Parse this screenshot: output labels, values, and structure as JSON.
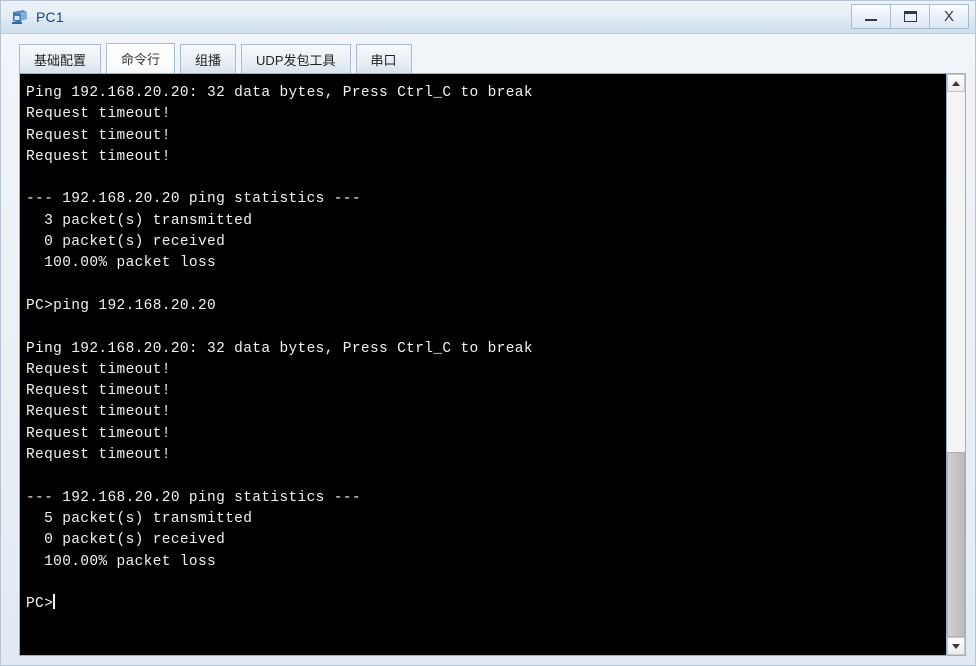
{
  "window": {
    "title": "PC1",
    "icon": "pc-device-icon",
    "controls": {
      "minimize_label": "—",
      "maximize_label": "▢",
      "close_label": "X"
    }
  },
  "tabs": [
    {
      "label": "基础配置",
      "active": false
    },
    {
      "label": "命令行",
      "active": true
    },
    {
      "label": "组播",
      "active": false
    },
    {
      "label": "UDP发包工具",
      "active": false
    },
    {
      "label": "串口",
      "active": false
    }
  ],
  "terminal": {
    "background": "#000000",
    "foreground": "#f2f2f2",
    "prompt": "PC>",
    "lines": [
      "Ping 192.168.20.20: 32 data bytes, Press Ctrl_C to break",
      "Request timeout!",
      "Request timeout!",
      "Request timeout!",
      "",
      "--- 192.168.20.20 ping statistics ---",
      "  3 packet(s) transmitted",
      "  0 packet(s) received",
      "  100.00% packet loss",
      "",
      "PC>ping 192.168.20.20",
      "",
      "Ping 192.168.20.20: 32 data bytes, Press Ctrl_C to break",
      "Request timeout!",
      "Request timeout!",
      "Request timeout!",
      "Request timeout!",
      "Request timeout!",
      "",
      "--- 192.168.20.20 ping statistics ---",
      "  5 packet(s) transmitted",
      "  0 packet(s) received",
      "  100.00% packet loss",
      ""
    ]
  },
  "scrollbar": {
    "up_arrow": "chevron-up-icon",
    "down_arrow": "chevron-down-icon",
    "thumb_top_pct": 66,
    "thumb_height_pct": 34
  }
}
